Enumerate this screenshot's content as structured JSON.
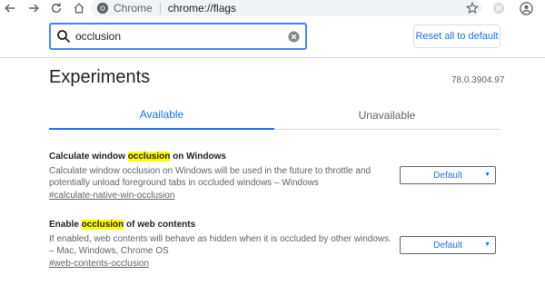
{
  "browser": {
    "site_label": "Chrome",
    "url": "chrome://flags"
  },
  "search": {
    "value": "occlusion",
    "reset_label": "Reset all to default"
  },
  "page": {
    "title": "Experiments",
    "version": "78.0.3904.97"
  },
  "tabs": [
    {
      "label": "Available",
      "active": true
    },
    {
      "label": "Unavailable",
      "active": false
    }
  ],
  "experiments": [
    {
      "title_pre": "Calculate window ",
      "title_hl": "occlusion",
      "title_post": " on Windows",
      "description": "Calculate window occlusion on Windows will be used in the future to throttle and potentially unload foreground tabs in occluded windows – Windows",
      "link": "#calculate-native-win-occlusion",
      "select_value": "Default"
    },
    {
      "title_pre": "Enable ",
      "title_hl": "occlusion",
      "title_post": " of web contents",
      "description": "If enabled, web contents will behave as hidden when it is occluded by other windows. – Mac, Windows, Chrome OS",
      "link": "#web-contents-occlusion",
      "select_value": "Default"
    }
  ],
  "colors": {
    "accent": "#1a73e8",
    "highlight": "#ffff00",
    "focus_border": "#4285f4"
  }
}
